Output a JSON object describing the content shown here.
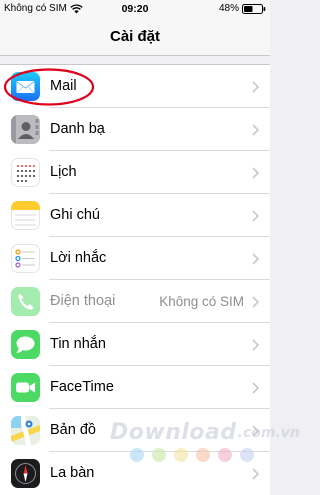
{
  "status_bar": {
    "carrier": "Không có SIM",
    "time": "09:20",
    "battery": "48%"
  },
  "nav": {
    "title": "Cài đặt"
  },
  "settings": [
    {
      "label": "Mail",
      "icon": "mail-icon"
    },
    {
      "label": "Danh bạ",
      "icon": "contacts-icon"
    },
    {
      "label": "Lịch",
      "icon": "calendar-icon"
    },
    {
      "label": "Ghi chú",
      "icon": "notes-icon"
    },
    {
      "label": "Lời nhắc",
      "icon": "reminders-icon"
    },
    {
      "label": "Điện thoại",
      "icon": "phone-icon",
      "value": "Không có SIM",
      "disabled": true
    },
    {
      "label": "Tin nhắn",
      "icon": "messages-icon"
    },
    {
      "label": "FaceTime",
      "icon": "facetime-icon"
    },
    {
      "label": "Bản đồ",
      "icon": "maps-icon"
    },
    {
      "label": "La bàn",
      "icon": "compass-icon"
    }
  ],
  "watermark": {
    "text": "Download",
    "domain": ".com.vn"
  },
  "colors": {
    "annotation": "#e0001b",
    "background": "#efeff4",
    "chevron": "#c7c7cc",
    "secondary_text": "#8e8e93"
  }
}
